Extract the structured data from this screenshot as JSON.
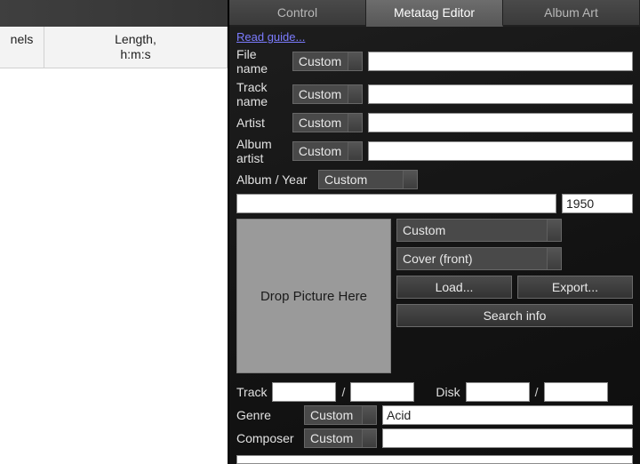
{
  "left": {
    "col1": "nels",
    "col2_line1": "Length,",
    "col2_line2": "h:m:s"
  },
  "tabs": {
    "control": "Control",
    "metatag": "Metatag Editor",
    "album_art": "Album Art"
  },
  "read_guide": "Read guide...",
  "labels": {
    "file_name": "File name",
    "track_name": "Track name",
    "artist": "Artist",
    "album_artist": "Album artist",
    "album_year": "Album / Year",
    "track": "Track",
    "disk": "Disk",
    "genre": "Genre",
    "composer": "Composer"
  },
  "combo_custom": "Custom",
  "year_value": "1950",
  "art": {
    "dropzone": "Drop Picture Here",
    "preset": "Custom",
    "type": "Cover (front)",
    "load": "Load...",
    "export": "Export...",
    "search": "Search info"
  },
  "genre_value": "Acid",
  "slash": "/"
}
